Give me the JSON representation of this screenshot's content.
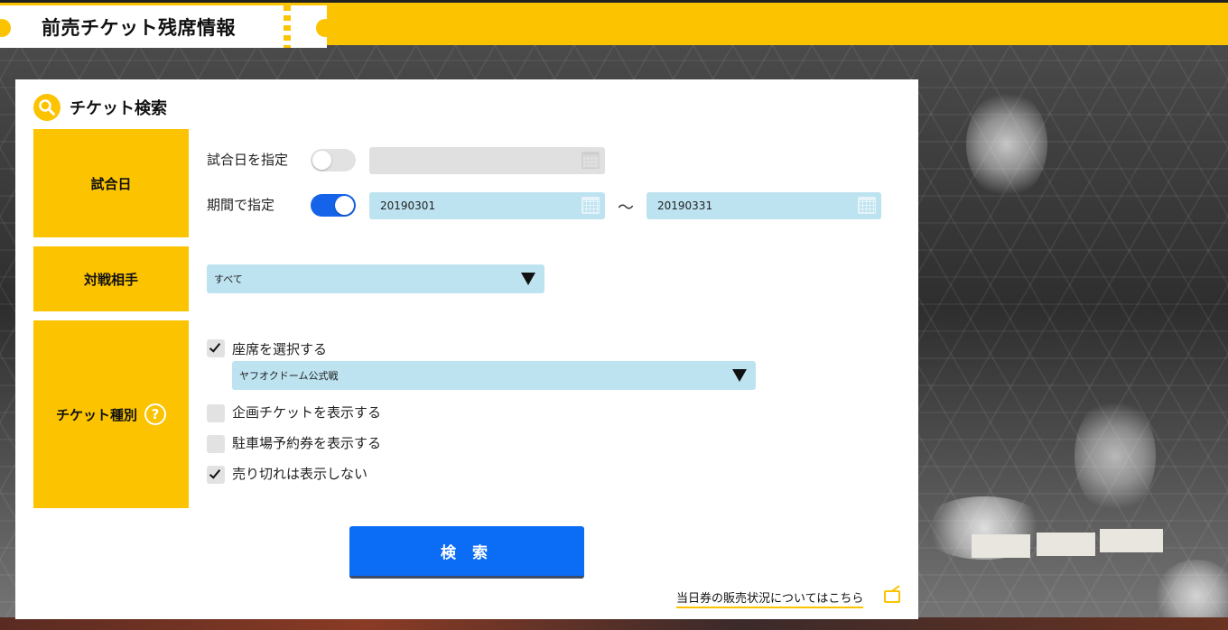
{
  "header": {
    "title": "前売チケット残席情報"
  },
  "panel": {
    "title": "チケット検索",
    "match_day": {
      "label": "試合日",
      "specify_date_label": "試合日を指定",
      "specify_date_toggle": false,
      "specify_date_value": "",
      "period_label": "期間で指定",
      "period_toggle": true,
      "period_from": "20190301",
      "separator": "〜",
      "period_to": "20190331"
    },
    "opponent": {
      "label": "対戦相手",
      "selected": "すべて"
    },
    "ticket_type": {
      "label": "チケット種別",
      "help_icon": "?",
      "select_seat": {
        "label": "座席を選択する",
        "checked": true
      },
      "seat_select_value": "ヤフオクドーム公式戦",
      "show_planned": {
        "label": "企画チケットを表示する",
        "checked": false
      },
      "show_parking": {
        "label": "駐車場予約券を表示する",
        "checked": false
      },
      "hide_sold_out": {
        "label": "売り切れは表示しない",
        "checked": true
      }
    },
    "search_button": "検 索",
    "same_day_link": "当日券の販売状況についてはこちら"
  },
  "colors": {
    "accent": "#fbc300",
    "primary_button": "#0b6cf5",
    "input_bg": "#bde3f1"
  },
  "icons": {
    "search": "search-icon",
    "calendar": "calendar-icon",
    "external": "external-link-icon",
    "help": "help-icon"
  }
}
